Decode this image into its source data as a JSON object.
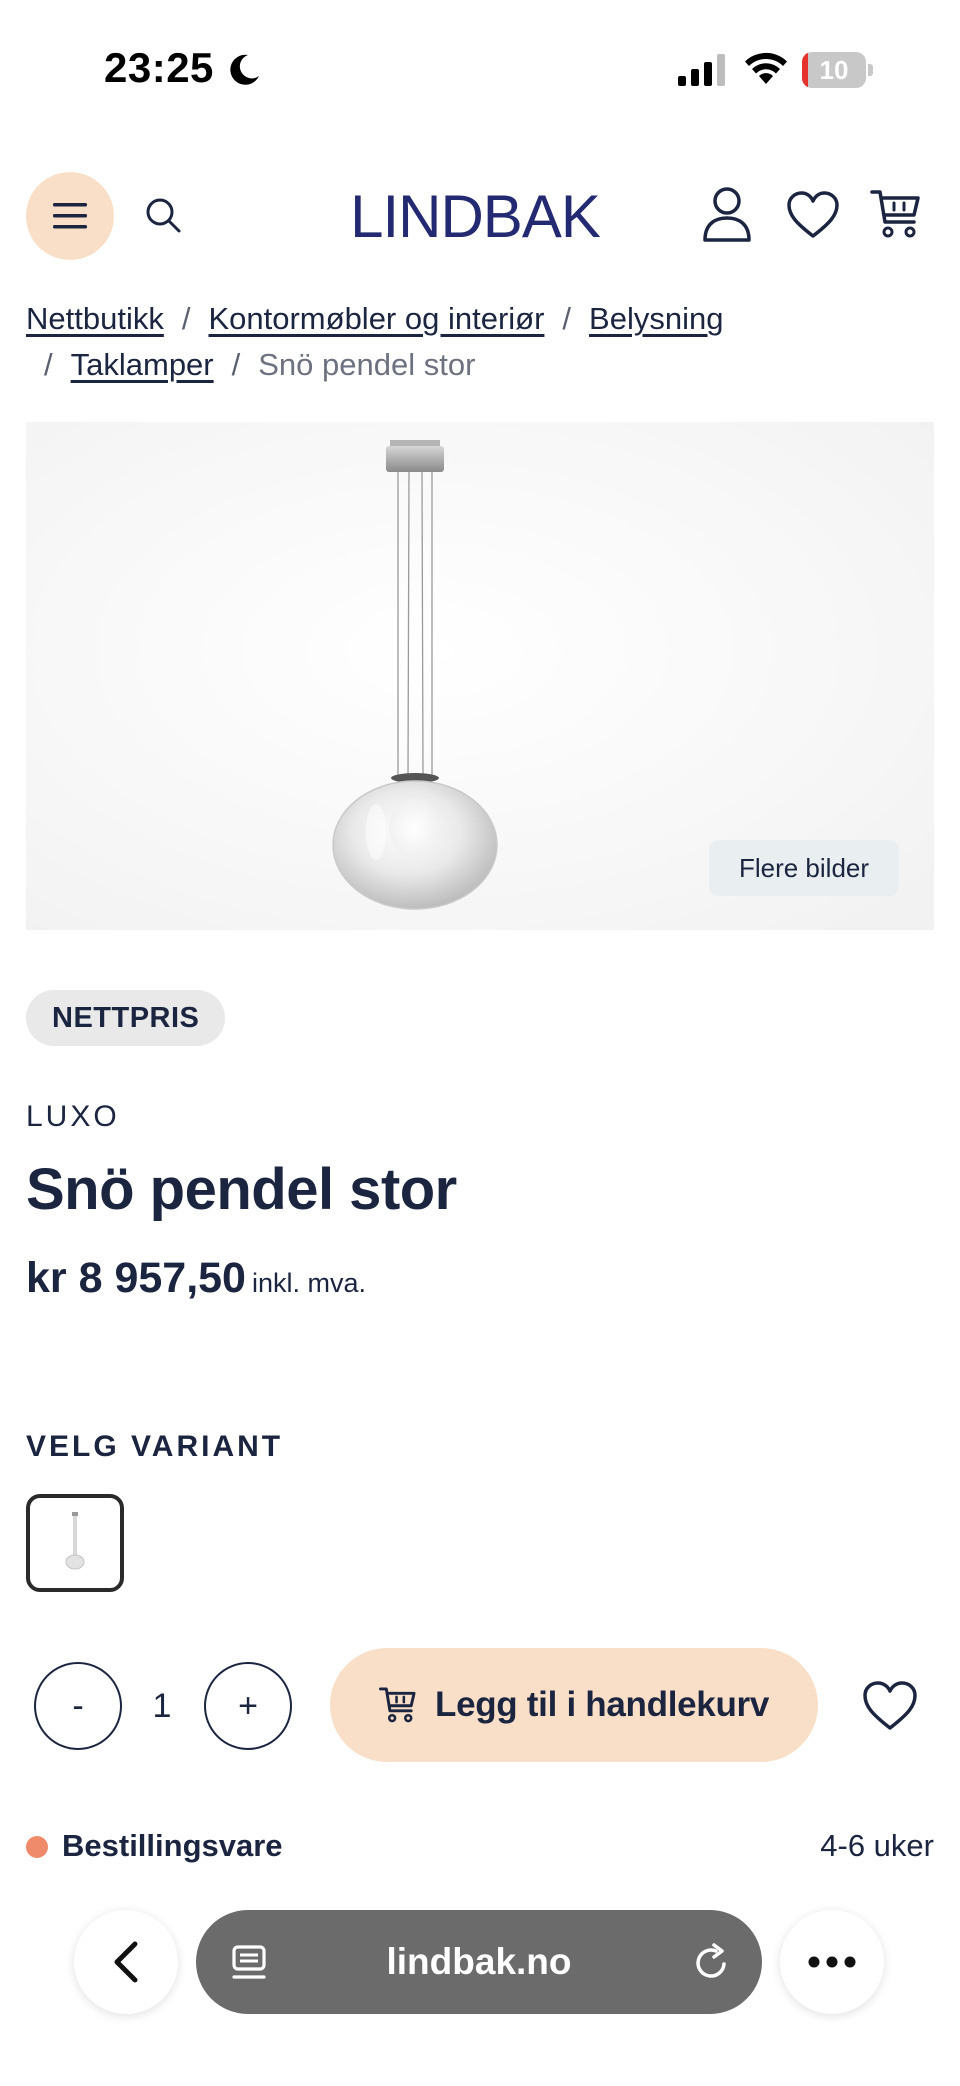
{
  "status_bar": {
    "time": "23:25",
    "battery_level": "10",
    "battery_fraction": 0.1,
    "battery_low_color": "#e5322d"
  },
  "header": {
    "logo": "LINDBAK",
    "accent_color": "#f9dfc8",
    "brand_color": "#232a72",
    "icons": [
      "menu-icon",
      "search-icon",
      "user-icon",
      "heart-icon",
      "cart-icon"
    ]
  },
  "breadcrumb": {
    "links": [
      "Nettbutikk",
      "Kontormøbler og interiør",
      "Belysning",
      "Taklamper"
    ],
    "current": "Snö pendel stor",
    "separator": "/"
  },
  "gallery": {
    "more_images_label": "Flere bilder"
  },
  "product": {
    "badge": "NETTPRIS",
    "brand": "LUXO",
    "title": "Snö pendel stor",
    "price": "kr 8 957,50",
    "price_suffix": "inkl. mva."
  },
  "variant": {
    "heading": "VELG VARIANT"
  },
  "purchase": {
    "decrement_label": "-",
    "quantity": "1",
    "increment_label": "+",
    "add_to_cart_label": "Legg til i handlekurv"
  },
  "availability": {
    "status": "Bestillingsvare",
    "status_color": "#ef8a6a",
    "delivery_time": "4-6 uker"
  },
  "browser": {
    "url": "lindbak.no"
  }
}
